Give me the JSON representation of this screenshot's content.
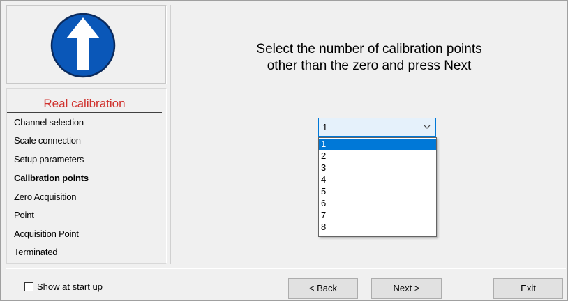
{
  "steps": {
    "title": "Real calibration",
    "items": [
      {
        "label": "Channel selection",
        "active": false
      },
      {
        "label": "Scale connection",
        "active": false
      },
      {
        "label": "Setup parameters",
        "active": false
      },
      {
        "label": "Calibration points",
        "active": true
      },
      {
        "label": "Zero Acquisition",
        "active": false
      },
      {
        "label": "Point",
        "active": false
      },
      {
        "label": "Acquisition Point",
        "active": false
      },
      {
        "label": "Terminated",
        "active": false
      }
    ]
  },
  "instruction": {
    "line1": "Select the number of calibration points",
    "line2": "other than the zero and press Next"
  },
  "points_select": {
    "value": "1",
    "options": [
      "1",
      "2",
      "3",
      "4",
      "5",
      "6",
      "7",
      "8"
    ],
    "selected_index": 0
  },
  "footer": {
    "show_at_startup_label": "Show at start up",
    "show_at_startup_checked": false,
    "back_label": "< Back",
    "next_label": "Next >",
    "exit_label": "Exit"
  },
  "colors": {
    "logo_circle": "#0a57b8",
    "steps_title": "#d0312d",
    "selection": "#0078d7"
  },
  "icons": {
    "logo": "up-arrow-sign-icon",
    "dropdown": "chevron-down-icon"
  }
}
